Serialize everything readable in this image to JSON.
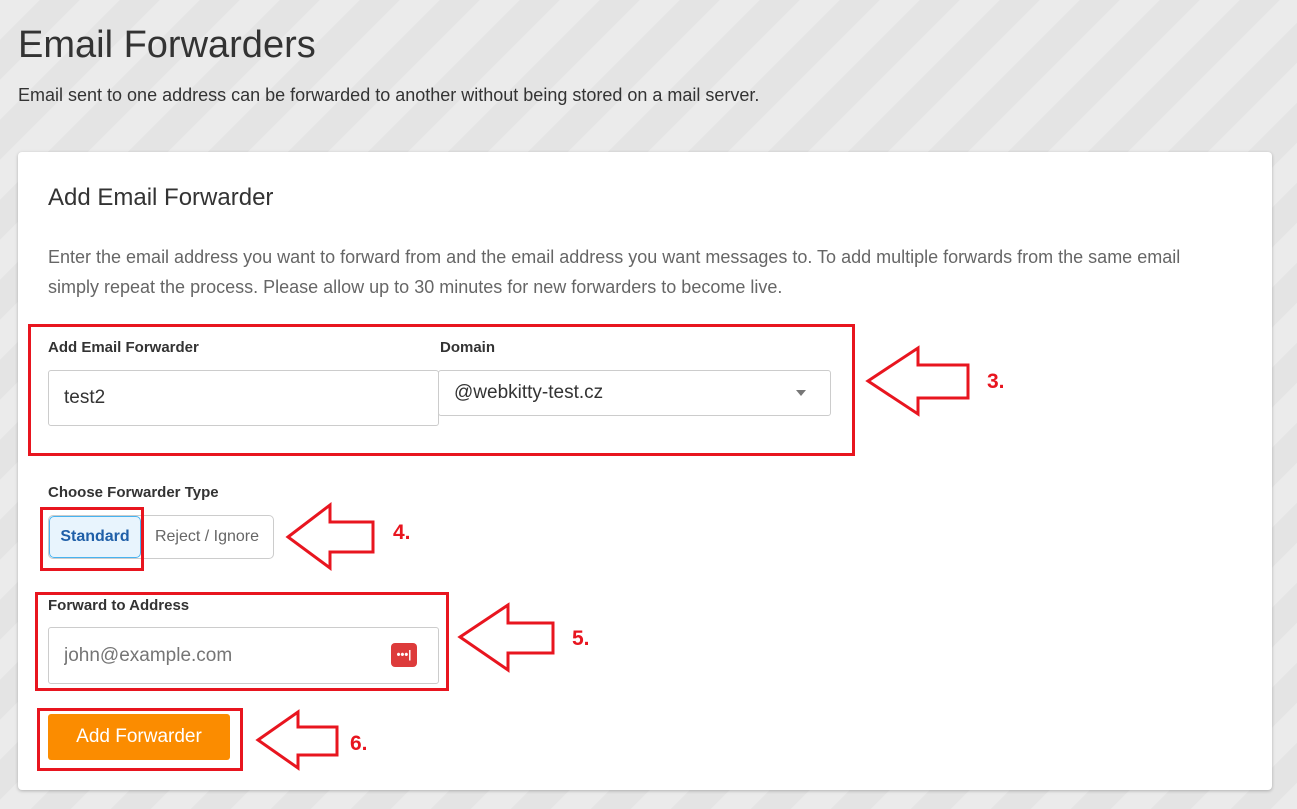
{
  "page": {
    "title": "Email Forwarders",
    "subtitle": "Email sent to one address can be forwarded to another without being stored on a mail server."
  },
  "card": {
    "title": "Add Email Forwarder",
    "description": "Enter the email address you want to forward from and the email address you want messages to. To add multiple forwards from the same email simply repeat the process. Please allow up to 30 minutes for new forwarders to become live.",
    "forwarder_label": "Add Email Forwarder",
    "forwarder_value": "test2",
    "domain_label": "Domain",
    "domain_value": "@webkitty-test.cz",
    "type_label": "Choose Forwarder Type",
    "type_options": [
      "Standard",
      "Reject / Ignore"
    ],
    "type_selected": "Standard",
    "forward_to_label": "Forward to Address",
    "forward_to_placeholder": "john@example.com",
    "forward_to_value": "",
    "submit_label": "Add Forwarder"
  },
  "annotations": [
    "3.",
    "4.",
    "5.",
    "6."
  ],
  "colors": {
    "accent": "#fb8c00",
    "annotation": "#e8151f",
    "selected": "#47b3f0"
  }
}
